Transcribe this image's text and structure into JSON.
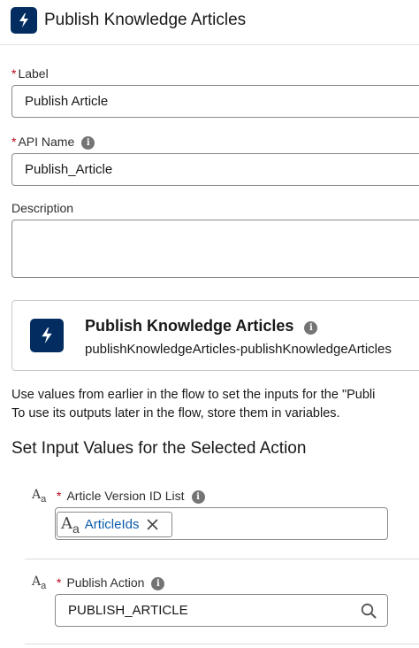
{
  "header": {
    "title": "Publish Knowledge Articles",
    "icon": "lightning-bolt-icon"
  },
  "form": {
    "label": {
      "required_mark": "*",
      "label": "Label",
      "value": "Publish Article"
    },
    "api_name": {
      "required_mark": "*",
      "label": "API Name",
      "info": "i",
      "value": "Publish_Article"
    },
    "description": {
      "label": "Description",
      "value": ""
    }
  },
  "action_card": {
    "title": "Publish Knowledge Articles",
    "info": "i",
    "subtitle": "publishKnowledgeArticles-publishKnowledgeArticles",
    "icon": "lightning-bolt-icon"
  },
  "help_text": {
    "line1": "Use values from earlier in the flow to set the inputs for the \"Publi",
    "line2": "To use its outputs later in the flow, store them in variables."
  },
  "section": {
    "title": "Set Input Values for the Selected Action"
  },
  "inputs": [
    {
      "type_icon": "A",
      "type_icon_sub": "a",
      "required_mark": "*",
      "label": "Article Version ID List",
      "info": "i",
      "pill": {
        "type_icon": "A",
        "type_icon_sub": "a",
        "text": "ArticleIds"
      }
    },
    {
      "type_icon": "A",
      "type_icon_sub": "a",
      "required_mark": "*",
      "label": "Publish Action",
      "info": "i",
      "value": "PUBLISH_ARTICLE"
    }
  ],
  "colors": {
    "brand_navy": "#032d60",
    "link_blue": "#0b5cab",
    "required_red": "#ba0517"
  }
}
